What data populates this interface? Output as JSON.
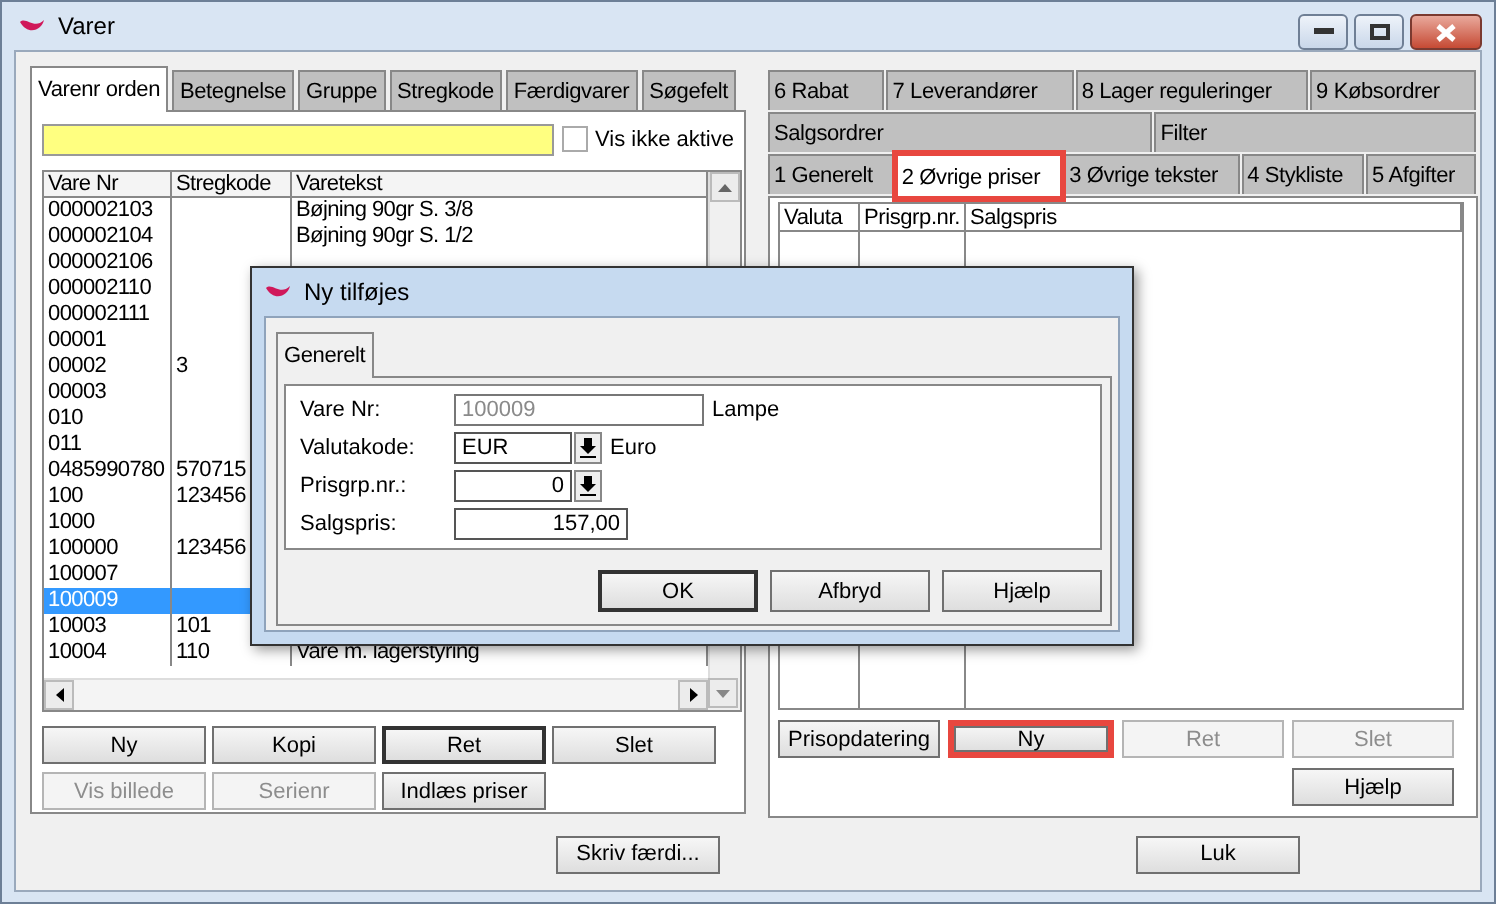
{
  "window": {
    "title": "Varer"
  },
  "left_tabs": [
    {
      "label": "Varenr orden",
      "selected": true
    },
    {
      "label": "Betegnelse",
      "selected": false
    },
    {
      "label": "Gruppe",
      "selected": false
    },
    {
      "label": "Stregkode",
      "selected": false
    },
    {
      "label": "Færdigvarer",
      "selected": false
    },
    {
      "label": "Søgefelt",
      "selected": false
    }
  ],
  "show_inactive": {
    "label": "Vis ikke aktive",
    "checked": false
  },
  "list": {
    "columns": [
      "Vare Nr",
      "Stregkode",
      "Varetekst"
    ],
    "rows": [
      {
        "cells": [
          "000002103",
          "",
          "Bøjning 90gr S. 3/8"
        ],
        "selected": false
      },
      {
        "cells": [
          "000002104",
          "",
          "Bøjning 90gr S. 1/2"
        ],
        "selected": false
      },
      {
        "cells": [
          "000002106",
          "",
          ""
        ],
        "selected": false
      },
      {
        "cells": [
          "000002110",
          "",
          ""
        ],
        "selected": false
      },
      {
        "cells": [
          "000002111",
          "",
          ""
        ],
        "selected": false
      },
      {
        "cells": [
          "00001",
          "",
          ""
        ],
        "selected": false
      },
      {
        "cells": [
          "00002",
          "3",
          ""
        ],
        "selected": false
      },
      {
        "cells": [
          "00003",
          "",
          ""
        ],
        "selected": false
      },
      {
        "cells": [
          "010",
          "",
          ""
        ],
        "selected": false
      },
      {
        "cells": [
          "011",
          "",
          ""
        ],
        "selected": false
      },
      {
        "cells": [
          "0485990780",
          "570715",
          ""
        ],
        "selected": false
      },
      {
        "cells": [
          "100",
          "123456",
          ""
        ],
        "selected": false
      },
      {
        "cells": [
          "1000",
          "",
          ""
        ],
        "selected": false
      },
      {
        "cells": [
          "100000",
          "123456",
          ""
        ],
        "selected": false
      },
      {
        "cells": [
          "100007",
          "",
          ""
        ],
        "selected": false
      },
      {
        "cells": [
          "100009",
          "",
          ""
        ],
        "selected": true
      },
      {
        "cells": [
          "10003",
          "101",
          ""
        ],
        "selected": false
      },
      {
        "cells": [
          "10004",
          "110",
          "Vare m. lagerstyring"
        ],
        "selected": false
      }
    ]
  },
  "left_buttons": [
    {
      "label": "Ny",
      "disabled": false,
      "default": false
    },
    {
      "label": "Kopi",
      "disabled": false,
      "default": false
    },
    {
      "label": "Ret",
      "disabled": false,
      "default": true
    },
    {
      "label": "Slet",
      "disabled": false,
      "default": false
    },
    {
      "label": "Vis billede",
      "disabled": true,
      "default": false
    },
    {
      "label": "Serienr",
      "disabled": true,
      "default": false
    },
    {
      "label": "Indlæs priser",
      "disabled": false,
      "default": false
    }
  ],
  "finish_button": {
    "label": "Skriv færdi..."
  },
  "right_tabs": [
    [
      {
        "label": "6 Rabat",
        "selected": false,
        "highlighted": false
      },
      {
        "label": "7 Leverandører",
        "selected": false,
        "highlighted": false
      },
      {
        "label": "8 Lager reguleringer",
        "selected": false,
        "highlighted": false
      },
      {
        "label": "9 Købsordrer",
        "selected": false,
        "highlighted": false
      }
    ],
    [
      {
        "label": "Salgsordrer",
        "selected": false,
        "highlighted": false
      },
      {
        "label": "Filter",
        "selected": false,
        "highlighted": false
      }
    ],
    [
      {
        "label": "1 Generelt",
        "selected": false,
        "highlighted": false
      },
      {
        "label": "2 Øvrige priser",
        "selected": true,
        "highlighted": true
      },
      {
        "label": "3 Øvrige tekster",
        "selected": false,
        "highlighted": false
      },
      {
        "label": "4 Stykliste",
        "selected": false,
        "highlighted": false
      },
      {
        "label": "5 Afgifter",
        "selected": false,
        "highlighted": false
      }
    ]
  ],
  "price_table": {
    "columns": [
      "Valuta",
      "Prisgrp.nr.",
      "Salgspris"
    ]
  },
  "right_buttons": [
    {
      "label": "Prisopdatering",
      "disabled": false,
      "highlighted": false
    },
    {
      "label": "Ny",
      "disabled": false,
      "highlighted": true
    },
    {
      "label": "Ret",
      "disabled": true,
      "highlighted": false
    },
    {
      "label": "Slet",
      "disabled": true,
      "highlighted": false
    },
    {
      "label": "Hjælp",
      "disabled": false,
      "highlighted": false
    }
  ],
  "close_button": {
    "label": "Luk"
  },
  "dialog": {
    "title": "Ny tilføjes",
    "tabs": [
      {
        "label": "Generelt",
        "selected": true
      }
    ],
    "fields": [
      {
        "label": "Vare Nr:",
        "value": "100009",
        "kind": "readonly",
        "note": "Lampe"
      },
      {
        "label": "Valutakode:",
        "value": "EUR",
        "kind": "combo",
        "note": "Euro"
      },
      {
        "label": "Prisgrp.nr.:",
        "value": "0",
        "kind": "combo-number"
      },
      {
        "label": "Salgspris:",
        "value": "157,00",
        "kind": "number"
      }
    ],
    "buttons": [
      {
        "label": "OK",
        "default": true
      },
      {
        "label": "Afbryd",
        "default": false
      },
      {
        "label": "Hjælp",
        "default": false
      }
    ]
  }
}
